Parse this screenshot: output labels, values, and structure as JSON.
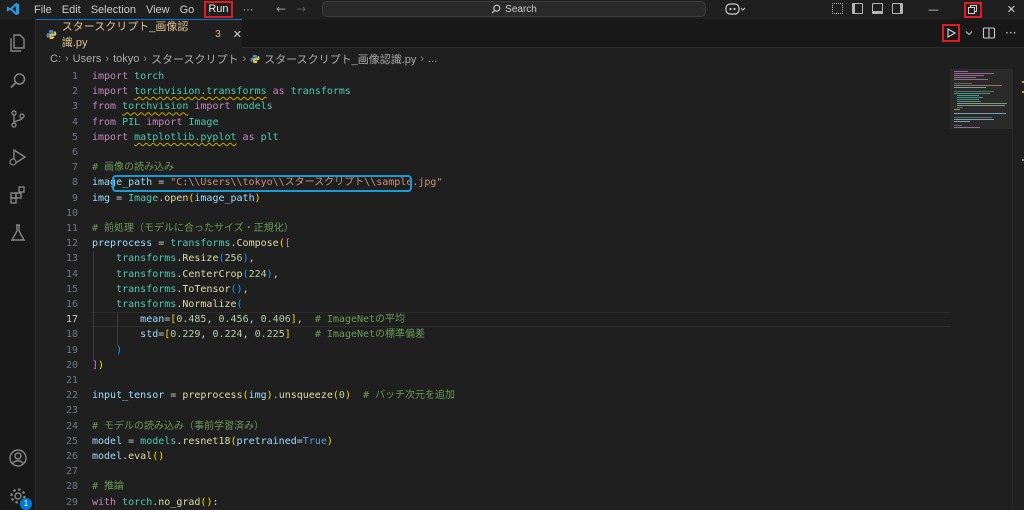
{
  "menu": {
    "file": "File",
    "edit": "Edit",
    "selection": "Selection",
    "view": "View",
    "go": "Go",
    "run": "Run",
    "more": "···"
  },
  "search": {
    "label": "Search"
  },
  "tab": {
    "name": "スタースクリプト_画像認識.py",
    "problems": "3",
    "close": "✕"
  },
  "breadcrumb": {
    "drive": "C:",
    "users": "Users",
    "user": "tokyo",
    "folder": "スタースクリプト",
    "file": "スタースクリプト_画像認識.py",
    "more": "..."
  },
  "activity": {
    "badge_count": "1"
  },
  "editor": {
    "active_line": 17,
    "line_numbers": [
      "1",
      "2",
      "3",
      "4",
      "5",
      "6",
      "7",
      "8",
      "9",
      "10",
      "11",
      "12",
      "13",
      "14",
      "15",
      "16",
      "17",
      "18",
      "19",
      "20",
      "21",
      "22",
      "23",
      "24",
      "25",
      "26",
      "27",
      "28",
      "29"
    ],
    "code": {
      "l1_kw": "import",
      "l1_mod": "torch",
      "l2_kw": "import",
      "l2_mod": "torchvision.transforms",
      "l2_as": "as",
      "l2_alias": "transforms",
      "l3_kw": "from",
      "l3_mod": "torchvision",
      "l3_imp": "import",
      "l3_name": "models",
      "l4_kw": "from",
      "l4_mod": "PIL",
      "l4_imp": "import",
      "l4_name": "Image",
      "l5_kw": "import",
      "l5_mod": "matplotlib.pyplot",
      "l5_as": "as",
      "l5_alias": "plt",
      "l7_cm": "# 画像の読み込み",
      "l8_var": "image_path",
      "l8_eq": " = ",
      "l8_str": "\"C:\\\\Users\\\\tokyo\\\\スタースクリプト\\\\sample.jpg\"",
      "l9_var": "img",
      "l9_eq": " = ",
      "l9_cls": "Image",
      "l9_dot": ".",
      "l9_fn": "open",
      "l9_arg": "image_path",
      "l11_cm": "# 前処理（モデルに合ったサイズ・正規化）",
      "l12_var": "preprocess",
      "l12_eq": " = ",
      "l12_mod": "transforms",
      "l12_dot": ".",
      "l12_fn": "Compose",
      "l13_mod": "transforms",
      "l13_fn": "Resize",
      "l13_num": "256",
      "l14_mod": "transforms",
      "l14_fn": "CenterCrop",
      "l14_num": "224",
      "l15_mod": "transforms",
      "l15_fn": "ToTensor",
      "l16_mod": "transforms",
      "l16_fn": "Normalize",
      "l17_var": "mean",
      "l17_n1": "0.485",
      "l17_n2": "0.456",
      "l17_n3": "0.406",
      "l17_cm": "# ImageNetの平均",
      "l18_var": "std",
      "l18_n1": "0.229",
      "l18_n2": "0.224",
      "l18_n3": "0.225",
      "l18_cm": "# ImageNetの標準偏差",
      "l22_var": "input_tensor",
      "l22_eq": " = ",
      "l22_fn": "preprocess",
      "l22_arg": "img",
      "l22_fn2": "unsqueeze",
      "l22_num": "0",
      "l22_cm": "# バッチ次元を追加",
      "l24_cm": "# モデルの読み込み（事前学習済み）",
      "l25_var": "model",
      "l25_eq": " = ",
      "l25_mod": "models",
      "l25_fn": "resnet18",
      "l25_kwarg": "pretrained",
      "l25_val": "True",
      "l26_var": "model",
      "l26_fn": "eval",
      "l28_cm": "# 推論",
      "l29_kw": "with",
      "l29_mod": "torch",
      "l29_fn": "no_grad"
    }
  },
  "colors": {
    "accent": "#0078d4",
    "annotation_red": "#e01b24",
    "annotation_blue": "#1a9bd7",
    "warning": "#cca700"
  }
}
